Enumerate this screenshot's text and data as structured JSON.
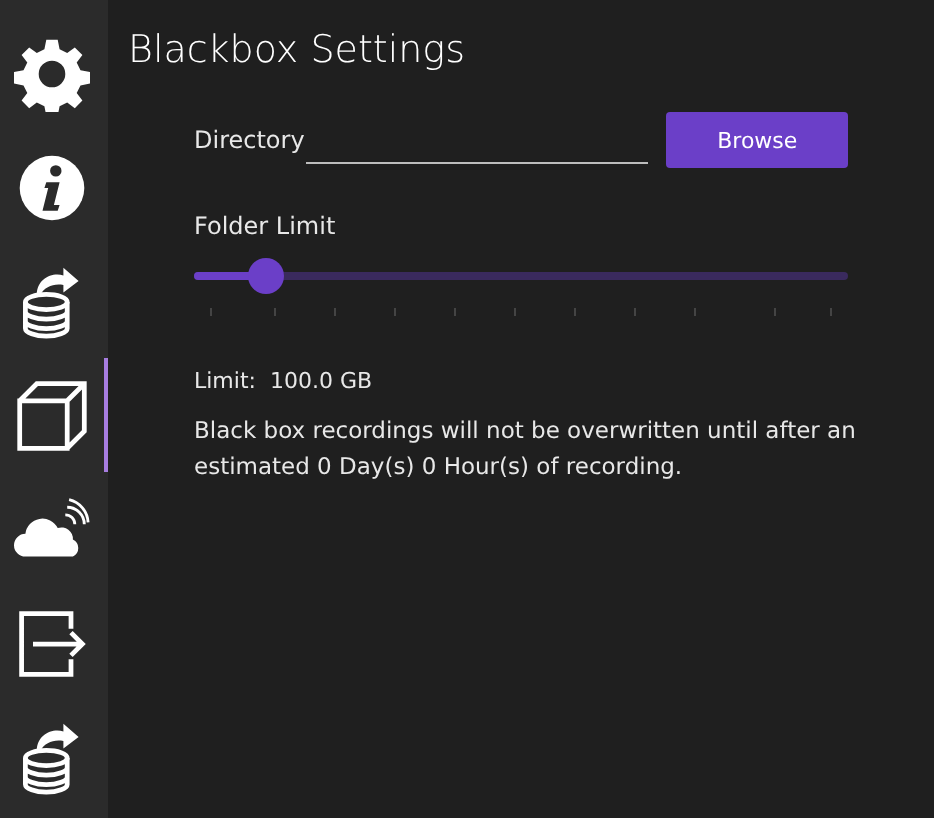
{
  "sidebar": {
    "items": [
      {
        "kind": "gear",
        "selected": false
      },
      {
        "kind": "info",
        "selected": false
      },
      {
        "kind": "db-in",
        "selected": false
      },
      {
        "kind": "cube",
        "selected": true
      },
      {
        "kind": "cloud",
        "selected": false
      },
      {
        "kind": "export",
        "selected": false
      },
      {
        "kind": "db-out",
        "selected": false
      }
    ]
  },
  "title": "Blackbox Settings",
  "directory": {
    "label": "Directory",
    "button": "Browse"
  },
  "folder_limit": {
    "label": "Folder Limit",
    "level": 0.11
  },
  "limit_text": "Limit:  100.0 GB",
  "note": "Black box recordings will not be overwritten until after an estimated 0 Day(s) 0 Hour(s) of recording."
}
